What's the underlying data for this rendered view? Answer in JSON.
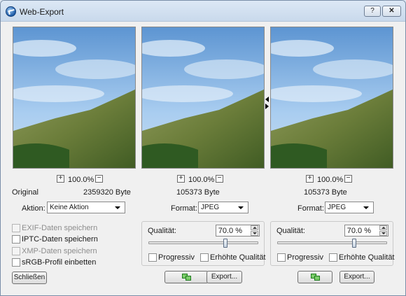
{
  "window": {
    "title": "Web-Export",
    "help_label": "?",
    "close_label": "✕"
  },
  "icons": {
    "app": "web-export-app-icon",
    "copy": "copy-settings-icon",
    "zoom_in": "plus-icon",
    "zoom_out": "minus-icon",
    "dropdown": "chevron-down-icon",
    "splitter": "splitter-arrows-icon"
  },
  "colors": {
    "title_bar": "#c9d9ec",
    "sky": "#6fa3d8",
    "hill": "#6b7d3a"
  },
  "plus": "+",
  "minus": "−",
  "panels": [
    {
      "zoom": "100.0%",
      "name": "Original",
      "size": "2359320 Byte",
      "select_label": "Aktion:",
      "select_value": "Keine Aktion"
    },
    {
      "zoom": "100.0%",
      "size": "105373 Byte",
      "select_label": "Format:",
      "select_value": "JPEG",
      "quality_label": "Qualität:",
      "quality_value": "70.0 %",
      "quality_level": 0.7,
      "progressive_label": "Progressiv",
      "progressive_checked": false,
      "enhanced_label": "Erhöhte Qualität",
      "enhanced_checked": false,
      "export_label": "Export..."
    },
    {
      "zoom": "100.0%",
      "size": "105373 Byte",
      "select_label": "Format:",
      "select_value": "JPEG",
      "quality_label": "Qualität:",
      "quality_value": "70.0 %",
      "quality_level": 0.7,
      "progressive_label": "Progressiv",
      "progressive_checked": false,
      "enhanced_label": "Erhöhte Qualität",
      "enhanced_checked": false,
      "export_label": "Export..."
    }
  ],
  "options": [
    {
      "label": "EXIF-Daten speichern",
      "checked": false,
      "enabled": false
    },
    {
      "label": "IPTC-Daten speichern",
      "checked": false,
      "enabled": true
    },
    {
      "label": "XMP-Daten speichern",
      "checked": false,
      "enabled": false
    },
    {
      "label": "sRGB-Profil einbetten",
      "checked": false,
      "enabled": true
    }
  ],
  "close_button": "Schließen"
}
